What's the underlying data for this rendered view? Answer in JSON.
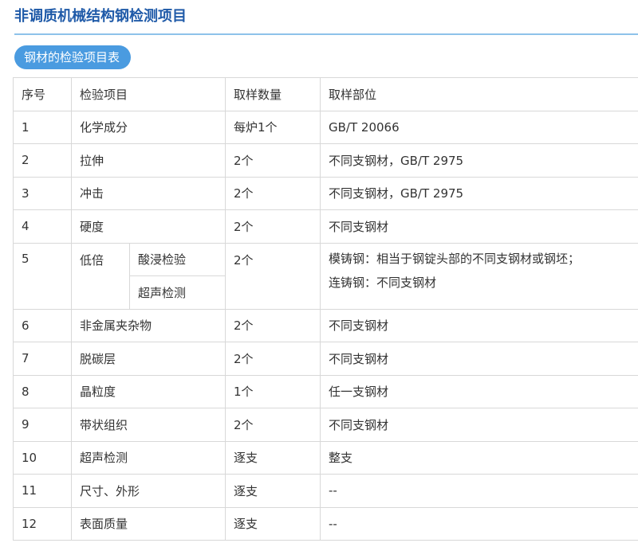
{
  "title": "非调质机械结构钢检测项目",
  "section_label": "钢材的检验项目表",
  "table": {
    "headers": [
      "序号",
      "检验项目",
      "取样数量",
      "取样部位"
    ],
    "rows": [
      {
        "no": "1",
        "item": "化学成分",
        "qty": "每炉1个",
        "loc": "GB/T 20066"
      },
      {
        "no": "2",
        "item": "拉伸",
        "qty": "2个",
        "loc": "不同支钢材，GB/T 2975"
      },
      {
        "no": "3",
        "item": "冲击",
        "qty": "2个",
        "loc": "不同支钢材，GB/T 2975"
      },
      {
        "no": "4",
        "item": "硬度",
        "qty": "2个",
        "loc": "不同支钢材"
      },
      {
        "no": "5",
        "item": "低倍",
        "subitems": [
          "酸浸检验",
          "超声检测"
        ],
        "qty": "2个",
        "loc_lines": [
          "模铸钢：相当于钢锭头部的不同支钢材或钢坯；",
          "连铸钢：不同支钢材"
        ]
      },
      {
        "no": "6",
        "item": "非金属夹杂物",
        "qty": "2个",
        "loc": "不同支钢材"
      },
      {
        "no": "7",
        "item": "脱碳层",
        "qty": "2个",
        "loc": "不同支钢材"
      },
      {
        "no": "8",
        "item": "晶粒度",
        "qty": "1个",
        "loc": "任一支钢材"
      },
      {
        "no": "9",
        "item": "带状组织",
        "qty": "2个",
        "loc": "不同支钢材"
      },
      {
        "no": "10",
        "item": "超声检测",
        "qty": "逐支",
        "loc": "整支"
      },
      {
        "no": "11",
        "item": "尺寸、外形",
        "qty": "逐支",
        "loc": "--"
      },
      {
        "no": "12",
        "item": "表面质量",
        "qty": "逐支",
        "loc": "--"
      }
    ]
  },
  "colors": {
    "title": "#1f5aa8",
    "rule": "#8ec2ea",
    "badge": "#4a9be0",
    "border": "#d8d8d8",
    "text": "#333333"
  }
}
